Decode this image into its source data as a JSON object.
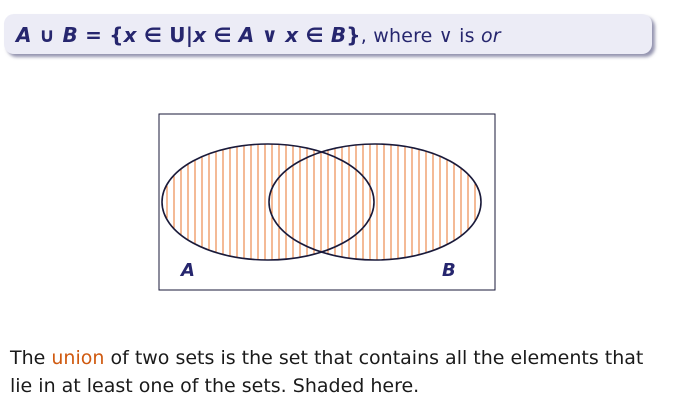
{
  "formula": {
    "set_a": "A",
    "union_op": " ∪ ",
    "set_b": "B",
    "equals": " = {",
    "var_x": "x",
    "in_op": " ∈ ",
    "universe": "U",
    "bar": "|",
    "var_x2": "x",
    "in_op2": " ∈ ",
    "set_a2": "A",
    "or_op": " ∨ ",
    "var_x3": "x",
    "in_op3": " ∈ ",
    "set_b2": "B",
    "close": "}",
    "where_text": ", where ∨ is ",
    "or_word": "or"
  },
  "diagram": {
    "label_a": "A",
    "label_b": "B",
    "shading_color": "#e8762c",
    "outline_color": "#1a1a3a"
  },
  "caption": {
    "text_before": "The ",
    "highlight": "union",
    "text_after": " of two sets is the set that contains all the elements that lie in at least one of the sets. Shaded here."
  }
}
